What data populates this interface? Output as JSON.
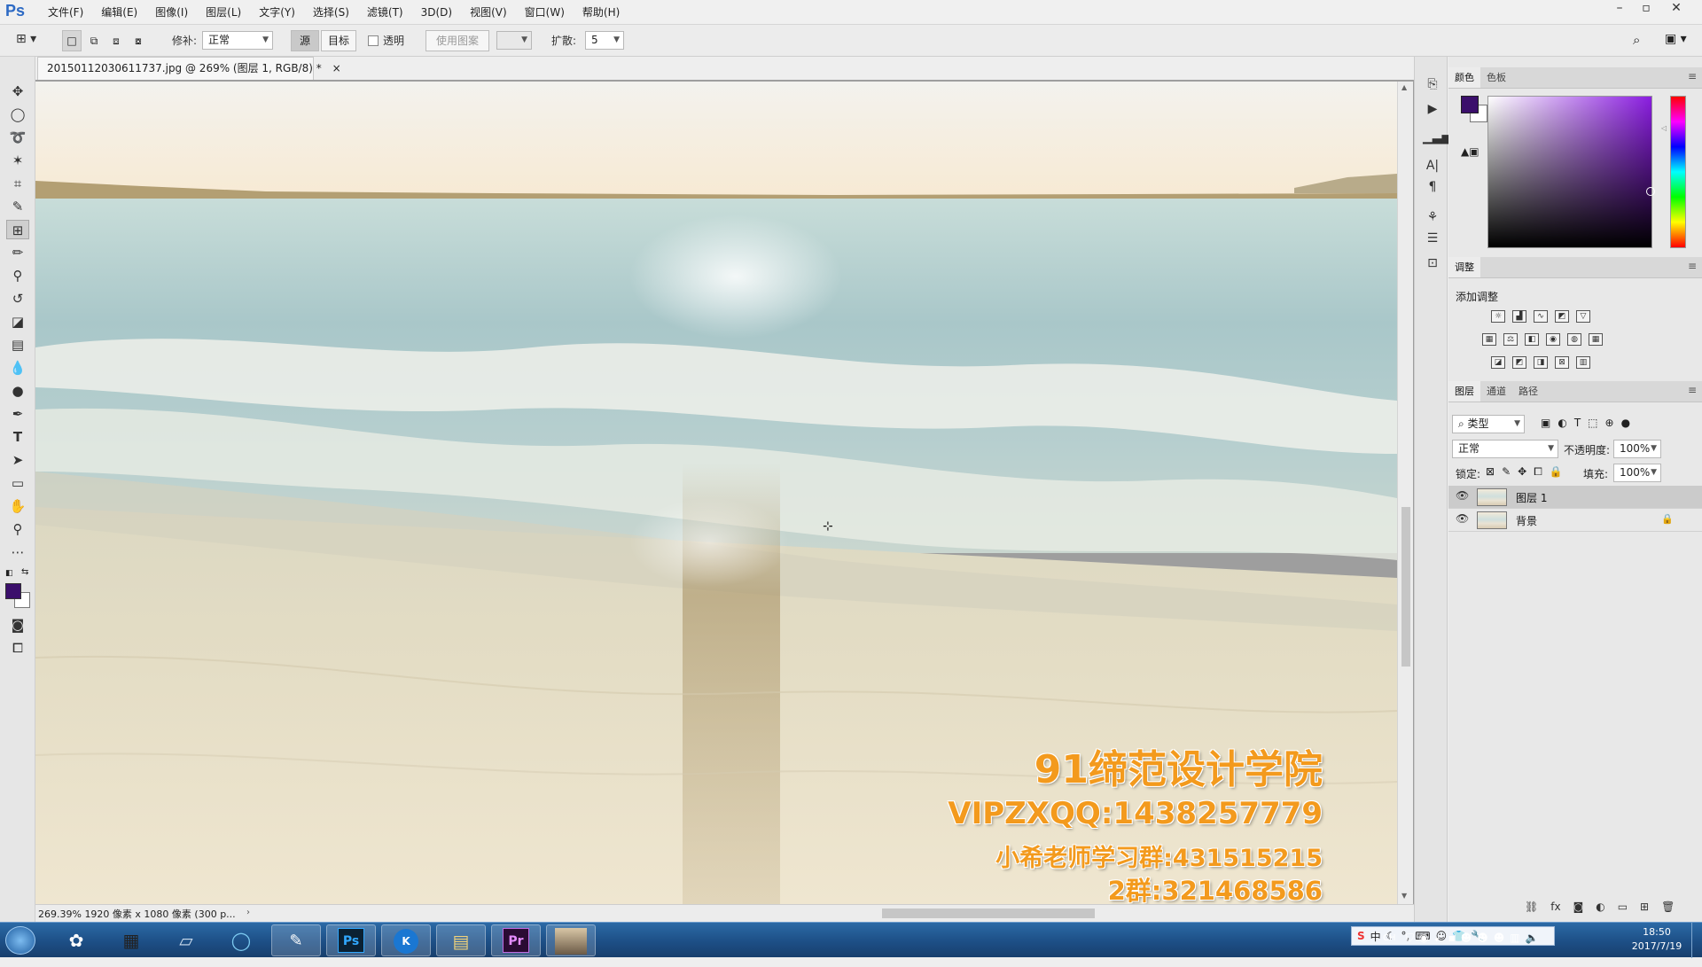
{
  "app": {
    "logo": "Ps",
    "menu": [
      "文件(F)",
      "编辑(E)",
      "图像(I)",
      "图层(L)",
      "文字(Y)",
      "选择(S)",
      "滤镜(T)",
      "3D(D)",
      "视图(V)",
      "窗口(W)",
      "帮助(H)"
    ]
  },
  "options": {
    "patch_label": "修补:",
    "patch_mode": "正常",
    "source_label": "源",
    "target_label": "目标",
    "transparent_label": "透明",
    "use_pattern_label": "使用图案",
    "diffusion_label": "扩散:",
    "diffusion_value": "5"
  },
  "document": {
    "tab_title": "20150112030611737.jpg @ 269% (图层 1, RGB/8) *",
    "close_glyph": "×",
    "status_text": "269.39%  1920 像素 x 1080 像素 (300 p..."
  },
  "watermark": {
    "line1": "91缔范设计学院",
    "line2": "VIPZXQQ:1438257779",
    "line3": "小希老师学习群:431515215",
    "line4": "2群:321468586"
  },
  "color_panel": {
    "tabs": [
      "颜色",
      "色板"
    ],
    "foreground": "#3b0f6b",
    "background": "#ffffff"
  },
  "adjustments_panel": {
    "tab": "调整",
    "heading": "添加调整"
  },
  "layers_panel": {
    "tabs": [
      "图层",
      "通道",
      "路径"
    ],
    "filter_kind": "类型",
    "blend_mode": "正常",
    "opacity_label": "不透明度:",
    "opacity_value": "100%",
    "lock_label": "锁定:",
    "fill_label": "填充:",
    "fill_value": "100%",
    "layers": [
      {
        "name": "图层 1",
        "selected": true,
        "locked": false
      },
      {
        "name": "背景",
        "selected": false,
        "locked": true
      }
    ],
    "footer_icons": [
      "link-icon",
      "fx-icon",
      "mask-icon",
      "adjustment-icon",
      "group-icon",
      "new-layer-icon",
      "trash-icon"
    ]
  },
  "taskbar": {
    "apps": [
      "ie-icon",
      "photoshop-icon",
      "kugou-icon",
      "explorer-icon",
      "premiere-icon",
      "photo-icon"
    ],
    "ps_label": "Ps",
    "k_label": "K",
    "pr_label": "Pr",
    "lang": "CH",
    "time": "18:50",
    "date": "2017/7/19"
  }
}
